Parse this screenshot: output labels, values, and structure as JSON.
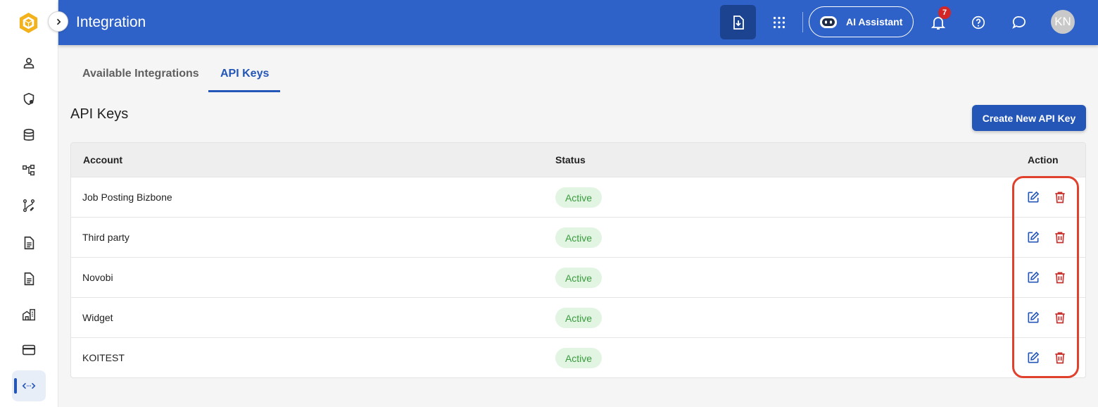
{
  "header": {
    "title": "Integration",
    "ai_assistant_label": "AI Assistant",
    "notification_count": "7",
    "avatar_initials": "KN",
    "color": "#2f62c9"
  },
  "sidebar": {
    "items": [
      {
        "icon": "user-icon"
      },
      {
        "icon": "shield-icon"
      },
      {
        "icon": "database-icon"
      },
      {
        "icon": "workflow-icon"
      },
      {
        "icon": "git-branch-icon"
      },
      {
        "icon": "document-icon"
      },
      {
        "icon": "document-alt-icon"
      },
      {
        "icon": "building-icon"
      },
      {
        "icon": "credit-card-icon"
      },
      {
        "icon": "code-arrows-icon",
        "active": true
      }
    ]
  },
  "tabs": [
    {
      "label": "Available Integrations",
      "active": false
    },
    {
      "label": "API Keys",
      "active": true
    }
  ],
  "section": {
    "title": "API Keys",
    "create_button": "Create New API Key"
  },
  "table": {
    "columns": [
      "Account",
      "Status",
      "Action"
    ],
    "rows": [
      {
        "account": "Job Posting Bizbone",
        "status": "Active"
      },
      {
        "account": "Third party",
        "status": "Active"
      },
      {
        "account": "Novobi",
        "status": "Active"
      },
      {
        "account": "Widget",
        "status": "Active"
      },
      {
        "account": "KOITEST",
        "status": "Active"
      }
    ]
  },
  "colors": {
    "accent": "#2456b8",
    "status_active_bg": "#e2f4e2",
    "status_active_text": "#3a9b3e",
    "delete": "#c9302c",
    "highlight": "#e0412d"
  }
}
